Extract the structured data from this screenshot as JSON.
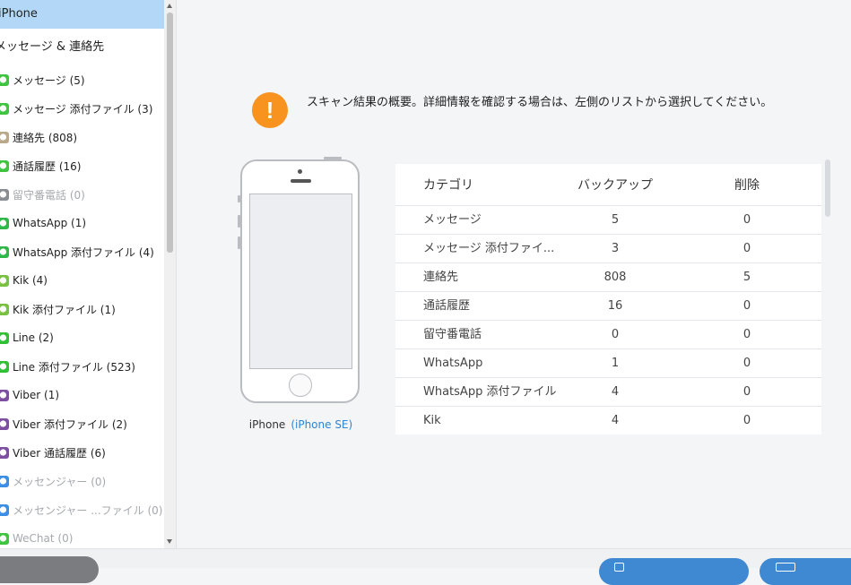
{
  "sidebar": {
    "device": "iPhone",
    "group": "メッセージ & 連絡先",
    "items": [
      {
        "label": "メッセージ (5)",
        "icon": "message-icon",
        "color": "#3fc43f",
        "disabled": false
      },
      {
        "label": "メッセージ 添付ファイル (3)",
        "icon": "message-attachment-icon",
        "color": "#3fc43f",
        "disabled": false
      },
      {
        "label": "連絡先 (808)",
        "icon": "contacts-icon",
        "color": "#b9a98a",
        "disabled": false
      },
      {
        "label": "通話履歴 (16)",
        "icon": "call-history-icon",
        "color": "#3fc43f",
        "disabled": false
      },
      {
        "label": "留守番電話 (0)",
        "icon": "voicemail-icon",
        "color": "#8a8d91",
        "disabled": true
      },
      {
        "label": "WhatsApp (1)",
        "icon": "whatsapp-icon",
        "color": "#2fb84a",
        "disabled": false
      },
      {
        "label": "WhatsApp 添付ファイル (4)",
        "icon": "whatsapp-attachment-icon",
        "color": "#2fb84a",
        "disabled": false
      },
      {
        "label": "Kik (4)",
        "icon": "kik-icon",
        "color": "#7ac142",
        "disabled": false
      },
      {
        "label": "Kik 添付ファイル (1)",
        "icon": "kik-attachment-icon",
        "color": "#7ac142",
        "disabled": false
      },
      {
        "label": "Line (2)",
        "icon": "line-icon",
        "color": "#2fc034",
        "disabled": false
      },
      {
        "label": "Line 添付ファイル (523)",
        "icon": "line-attachment-icon",
        "color": "#2fc034",
        "disabled": false
      },
      {
        "label": "Viber (1)",
        "icon": "viber-icon",
        "color": "#7d4fa3",
        "disabled": false
      },
      {
        "label": "Viber 添付ファイル (2)",
        "icon": "viber-attachment-icon",
        "color": "#7d4fa3",
        "disabled": false
      },
      {
        "label": "Viber 通話履歴 (6)",
        "icon": "viber-call-icon",
        "color": "#7d4fa3",
        "disabled": false
      },
      {
        "label": "メッセンジャー (0)",
        "icon": "messenger-icon",
        "color": "#3a8ee6",
        "disabled": true
      },
      {
        "label": "メッセンジャー ...ファイル (0)",
        "icon": "messenger-attachment-icon",
        "color": "#3a8ee6",
        "disabled": true
      },
      {
        "label": "WeChat (0)",
        "icon": "wechat-icon",
        "color": "#3fc43f",
        "disabled": true
      }
    ]
  },
  "notice": {
    "icon_symbol": "!",
    "text": "スキャン結果の概要。詳細情報を確認する場合は、左側のリストから選択してください。"
  },
  "device": {
    "name": "iPhone",
    "model": "(iPhone SE)"
  },
  "summary_table": {
    "headers": [
      "カテゴリ",
      "バックアップ",
      "削除"
    ],
    "rows": [
      {
        "category": "メッセージ",
        "backup": "5",
        "deleted": "0"
      },
      {
        "category": "メッセージ 添付ファイ...",
        "backup": "3",
        "deleted": "0"
      },
      {
        "category": "連絡先",
        "backup": "808",
        "deleted": "5"
      },
      {
        "category": "通話履歴",
        "backup": "16",
        "deleted": "0"
      },
      {
        "category": "留守番電話",
        "backup": "0",
        "deleted": "0"
      },
      {
        "category": "WhatsApp",
        "backup": "1",
        "deleted": "0"
      },
      {
        "category": "WhatsApp 添付ファイル",
        "backup": "4",
        "deleted": "0"
      },
      {
        "category": "Kik",
        "backup": "4",
        "deleted": "0"
      }
    ]
  },
  "colors": {
    "accent": "#3f89d2",
    "warning": "#f7931e",
    "selected": "#b3d8f7",
    "link": "#2b86d5"
  }
}
